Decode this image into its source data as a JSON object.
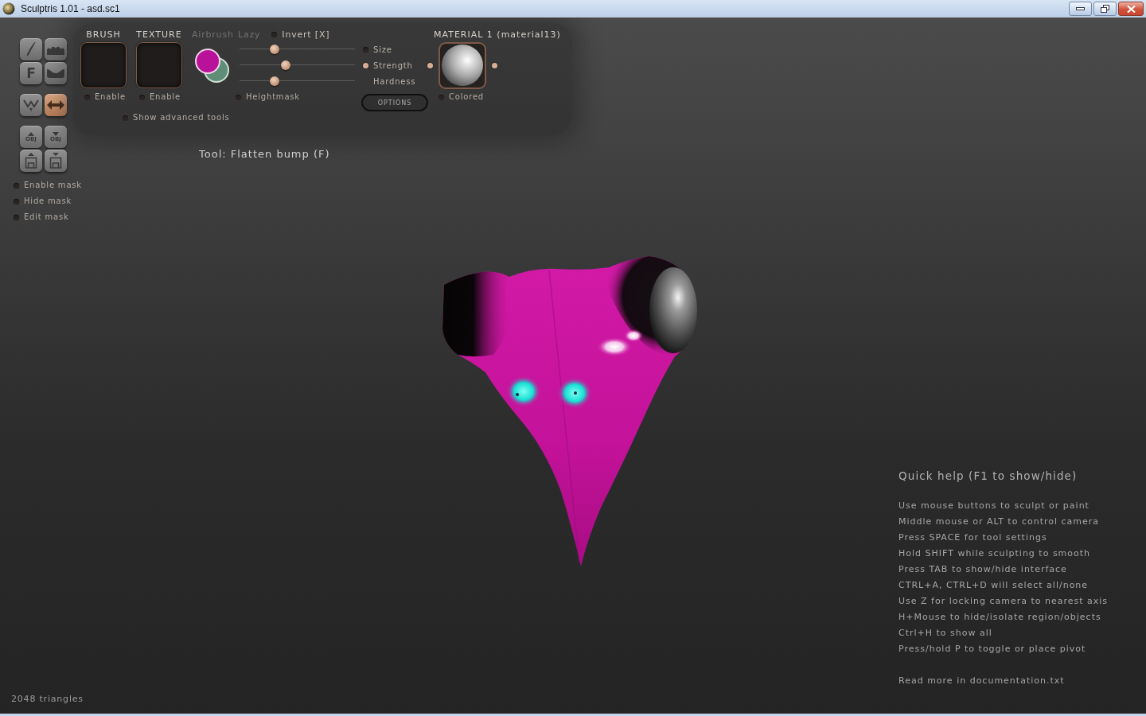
{
  "window": {
    "title": "Sculptris 1.01 - asd.sc1"
  },
  "toolbox": {
    "groups": [
      {
        "buttons": [
          {
            "kind": "brush",
            "on": false
          },
          {
            "kind": "bump",
            "on": false
          },
          {
            "kind": "letter",
            "label": "F",
            "on": false
          },
          {
            "kind": "dent",
            "on": false
          }
        ]
      },
      {
        "buttons": [
          {
            "kind": "zigzag",
            "on": false
          },
          {
            "kind": "double-arrow",
            "on": true
          }
        ]
      },
      {
        "buttons": [
          {
            "kind": "obj-up",
            "label": "OBJ",
            "on": false
          },
          {
            "kind": "obj-down",
            "label": "OBJ",
            "on": false
          },
          {
            "kind": "floppy-up",
            "on": false
          },
          {
            "kind": "floppy-down",
            "on": false
          }
        ]
      }
    ]
  },
  "mask_options": [
    {
      "label": "Enable mask",
      "on": false
    },
    {
      "label": "Hide mask",
      "on": false
    },
    {
      "label": "Edit mask",
      "on": false
    }
  ],
  "brush_panel": {
    "brush": {
      "heading": "BRUSH",
      "toggle": {
        "label": "Enable",
        "on": false
      }
    },
    "texture": {
      "heading": "TEXTURE",
      "toggle": {
        "label": "Enable",
        "on": false
      }
    },
    "modes": [
      {
        "label": "Airbrush",
        "on": false
      },
      {
        "label": "Lazy",
        "on": false
      }
    ],
    "invert": {
      "label": "Invert [X]",
      "on": false
    },
    "colors": [
      {
        "color": "#b8129b"
      },
      {
        "color": "#5e8e78"
      }
    ],
    "sliders": [
      {
        "label": "Size",
        "level": 0.3,
        "pressure": false
      },
      {
        "label": "Strength",
        "level": 0.4,
        "pressure": true
      },
      {
        "label": "Hardness",
        "level": 0.3
      }
    ],
    "heightmask": {
      "label": "Heightmask",
      "on": false
    },
    "options_button": "OPTIONS",
    "advanced_tools": {
      "label": "Show advanced tools",
      "on": false
    }
  },
  "material": {
    "heading": "MATERIAL 1 (material13)",
    "colored": {
      "label": "Colored",
      "on": false
    }
  },
  "tool_label": "Tool: Flatten bump (F)",
  "quick_help": {
    "title": "Quick help (F1 to show/hide)",
    "lines": [
      "Use mouse buttons to sculpt or paint",
      "Middle mouse or ALT to control camera",
      "Press SPACE for tool settings",
      "Hold SHIFT while sculpting to smooth",
      "Press TAB to show/hide interface",
      "CTRL+A, CTRL+D will select all/none",
      "Use Z for locking camera to nearest axis",
      "H+Mouse to hide/isolate region/objects",
      "Ctrl+H to show all",
      "Press/hold P to toggle or place pivot"
    ],
    "footer": "Read more in documentation.txt"
  },
  "status": "2048 triangles"
}
